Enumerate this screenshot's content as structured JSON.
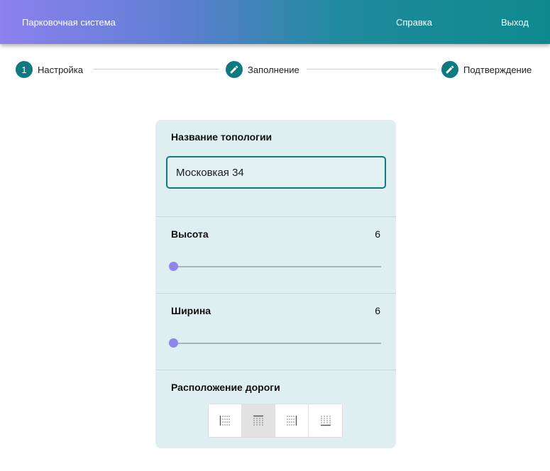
{
  "header": {
    "app_title": "Парковочная система",
    "help_label": "Справка",
    "logout_label": "Выход"
  },
  "stepper": {
    "steps": [
      {
        "number": "1",
        "label": "Настройка",
        "icon": "number"
      },
      {
        "label": "Заполнение",
        "icon": "pencil-icon"
      },
      {
        "label": "Подтверждение",
        "icon": "pencil-icon"
      }
    ]
  },
  "form": {
    "name": {
      "label": "Название топологии",
      "value": "Московкая 34"
    },
    "height": {
      "label": "Высота",
      "value": "6",
      "slider_fraction": 0
    },
    "width": {
      "label": "Ширина",
      "value": "6",
      "slider_fraction": 0
    },
    "road": {
      "label": "Расположение дороги",
      "options": [
        "road-left-icon",
        "road-top-icon",
        "road-right-icon",
        "road-bottom-icon"
      ],
      "selected_index": 1
    }
  },
  "colors": {
    "accent": "#0d7a80",
    "slider_thumb": "#8f86ec",
    "card_background": "#dfeef1"
  }
}
